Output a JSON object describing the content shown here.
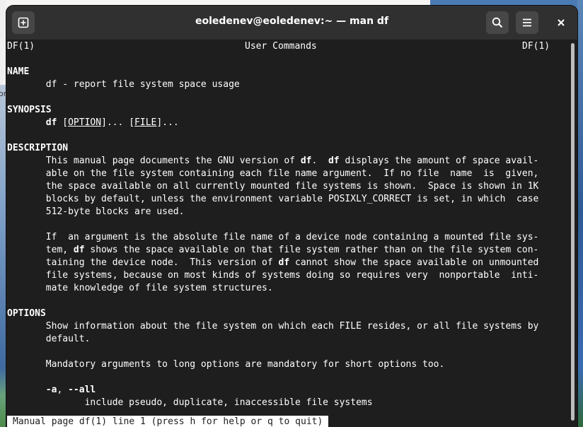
{
  "window": {
    "title": "eoledenev@eoledenev:~ — man df",
    "buttons": {
      "new_tab_icon": "plus-square-icon",
      "search_icon": "search-icon",
      "menu_icon": "hamburger-menu-icon",
      "close_icon": "close-icon"
    }
  },
  "background": {
    "left_text": "or"
  },
  "man": {
    "header_left": "DF(1)",
    "header_center": "User Commands",
    "header_right": "DF(1)",
    "name_heading": "NAME",
    "name_text": "       df - report file system space usage",
    "synopsis_heading": "SYNOPSIS",
    "synopsis_indent": "       ",
    "synopsis_cmd": "df",
    "synopsis_sp1": " [",
    "synopsis_option": "OPTION",
    "synopsis_mid": "]... [",
    "synopsis_file": "FILE",
    "synopsis_end": "]...",
    "description_heading": "DESCRIPTION",
    "desc_l1_a": "       This manual page documents the GNU version of ",
    "desc_l1_b": "df",
    "desc_l1_c": ".  ",
    "desc_l1_d": "df",
    "desc_l1_e": " displays the amount of space avail-",
    "desc_l2": "       able on the file system containing each file name argument.  If no file  name  is  given,",
    "desc_l3": "       the space available on all currently mounted file systems is shown.  Space is shown in 1K",
    "desc_l4": "       blocks by default, unless the environment variable POSIXLY_CORRECT is set, in which  case",
    "desc_l5": "       512-byte blocks are used.",
    "desc_p2_l1": "       If  an argument is the absolute file name of a device node containing a mounted file sys-",
    "desc_p2_l2_a": "       tem, ",
    "desc_p2_l2_b": "df",
    "desc_p2_l2_c": " shows the space available on that file system rather than on the file system con-",
    "desc_p2_l3_a": "       taining the device node.  This version of ",
    "desc_p2_l3_b": "df",
    "desc_p2_l3_c": " cannot show the space available on unmounted",
    "desc_p2_l4": "       file systems, because on most kinds of systems doing so requires very  nonportable  inti-",
    "desc_p2_l5": "       mate knowledge of file system structures.",
    "options_heading": "OPTIONS",
    "opt_l1": "       Show information about the file system on which each FILE resides, or all file systems by",
    "opt_l2": "       default.",
    "opt_l3": "       Mandatory arguments to long options are mandatory for short options too.",
    "opt_a_indent": "       ",
    "opt_a_short": "-a",
    "opt_a_sep": ", ",
    "opt_a_long": "--all",
    "opt_a_desc": "              include pseudo, duplicate, inaccessible file systems"
  },
  "status_bar": "Manual page df(1) line 1 (press h for help or q to quit)"
}
